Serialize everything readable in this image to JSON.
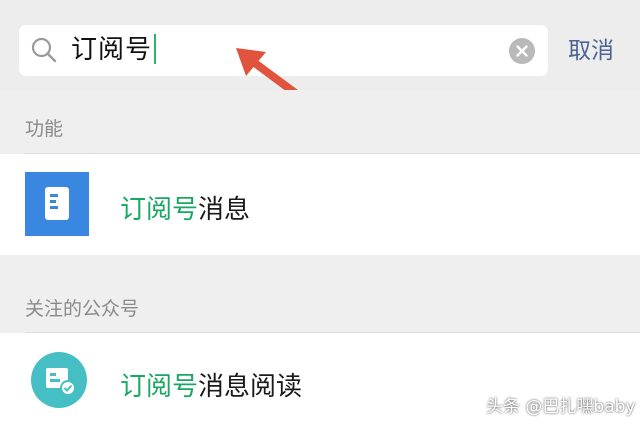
{
  "search": {
    "query": "订阅号",
    "cancel_label": "取消"
  },
  "sections": [
    {
      "header": "功能",
      "result": {
        "highlight": "订阅号",
        "rest": "消息",
        "icon": "document-icon"
      }
    },
    {
      "header": "关注的公众号",
      "result": {
        "highlight": "订阅号",
        "rest": "消息阅读",
        "icon": "subscription-account-icon"
      }
    }
  ],
  "watermark": "头条 @巴扎嘿baby",
  "colors": {
    "highlight": "#1aa764",
    "cancel": "#4a6494",
    "arrow": "#e0533c",
    "function_icon_bg": "#3987e0",
    "account_icon_bg": "#45bfc4"
  }
}
